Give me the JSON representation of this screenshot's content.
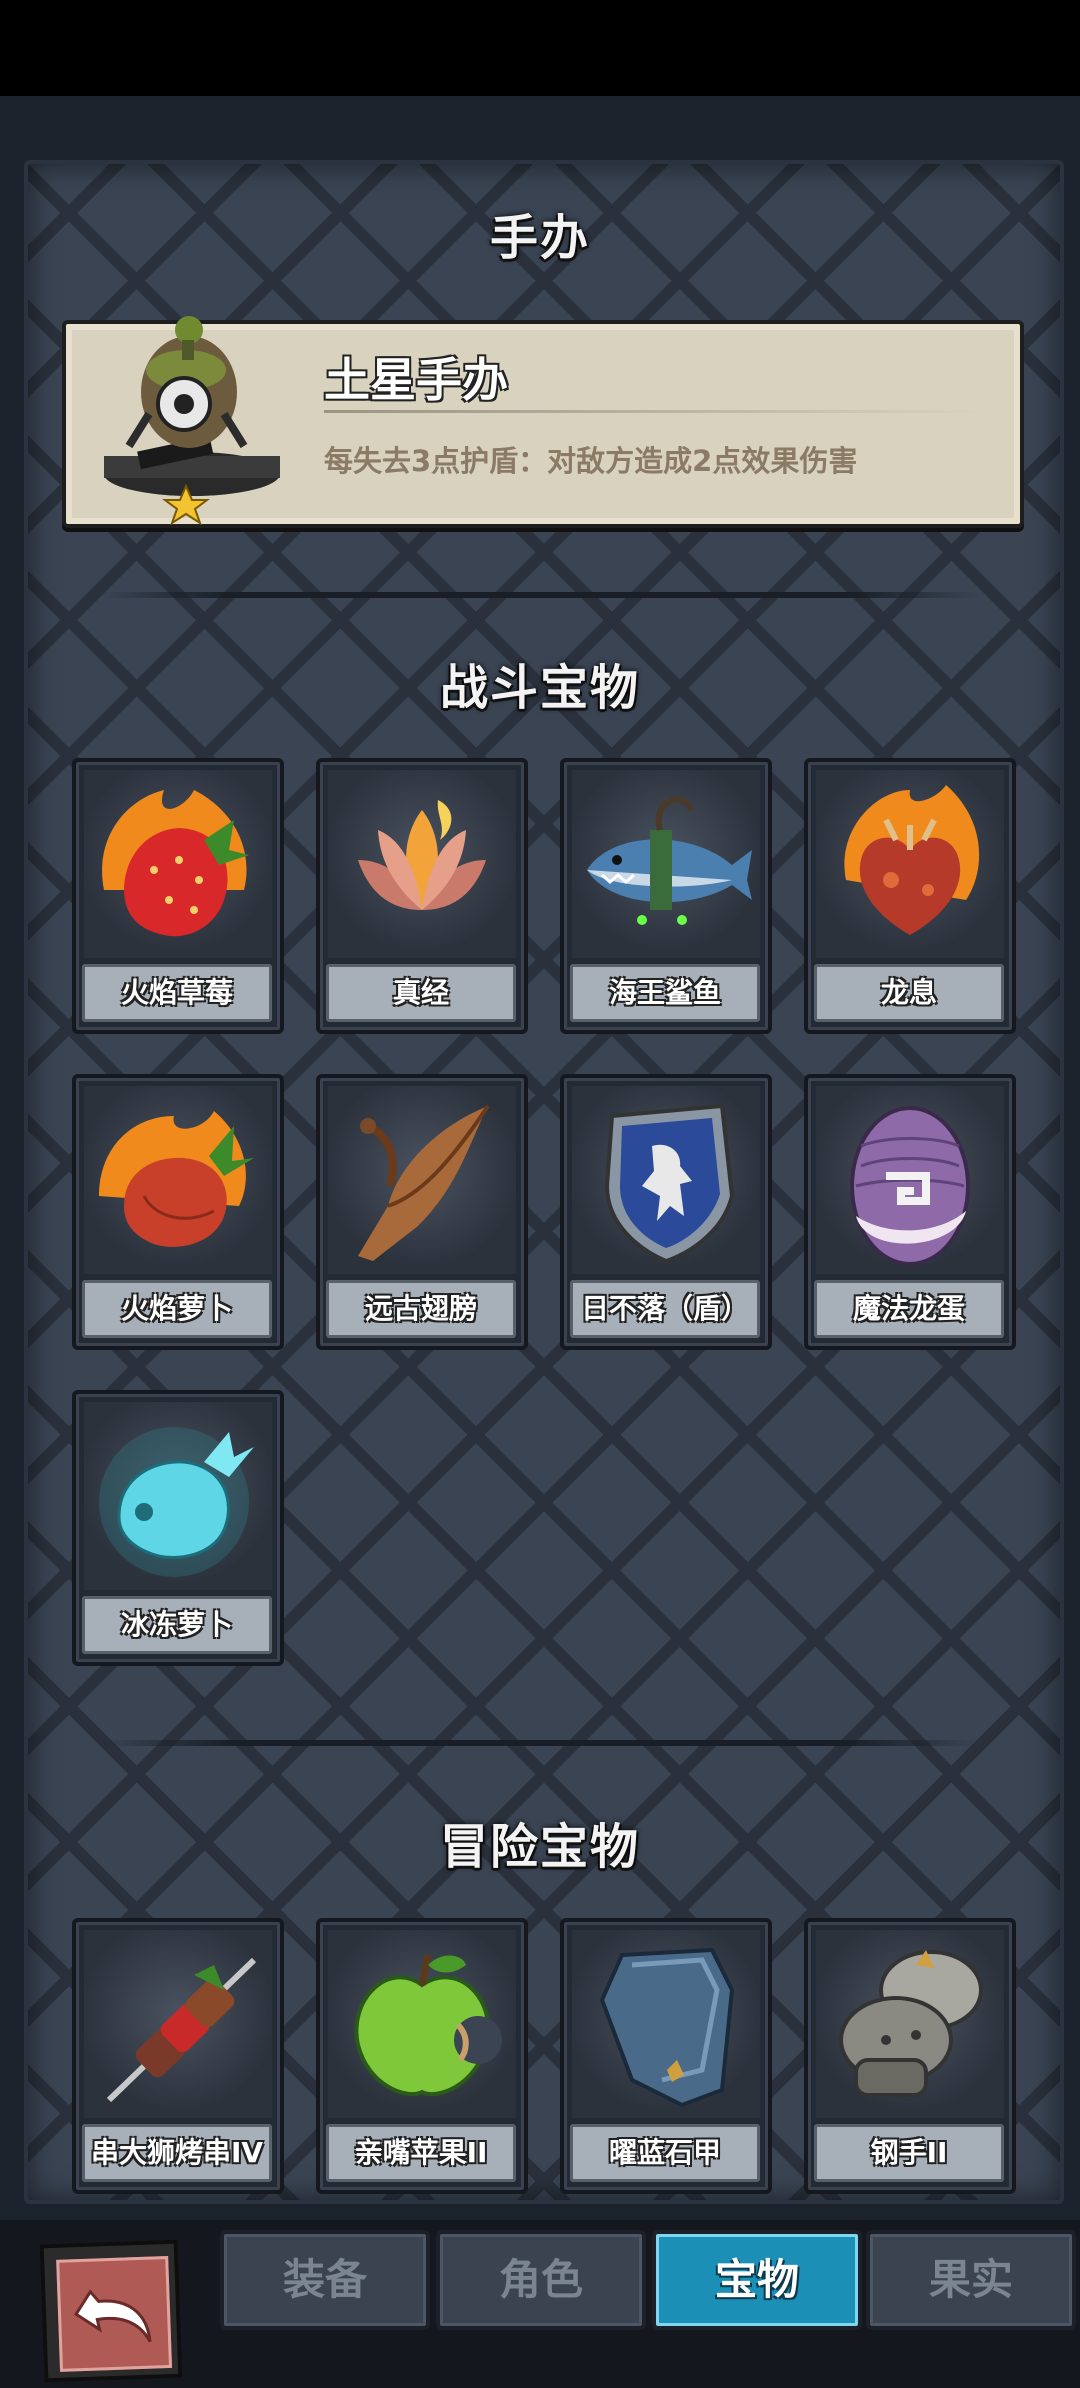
{
  "figure_section": {
    "title": "手办",
    "figure": {
      "name": "土星手办",
      "description": "每失去3点护盾：对敌方造成2点效果伤害"
    }
  },
  "battle_section": {
    "title": "战斗宝物",
    "items": [
      {
        "label": "火焰草莓",
        "icon": "flaming-strawberry-icon"
      },
      {
        "label": "真经",
        "icon": "burning-lotus-icon"
      },
      {
        "label": "海王鲨鱼",
        "icon": "shark-fish-icon"
      },
      {
        "label": "龙息",
        "icon": "flaming-heart-icon"
      },
      {
        "label": "火焰萝卜",
        "icon": "flaming-radish-icon"
      },
      {
        "label": "远古翅膀",
        "icon": "ancient-wing-icon"
      },
      {
        "label": "日不落（盾）",
        "icon": "lion-shield-icon"
      },
      {
        "label": "魔法龙蛋",
        "icon": "dragon-egg-icon"
      },
      {
        "label": "冰冻萝卜",
        "icon": "frozen-radish-icon"
      }
    ]
  },
  "adventure_section": {
    "title": "冒险宝物",
    "items": [
      {
        "label": "串大狮烤串IV",
        "icon": "kebab-skewer-icon"
      },
      {
        "label": "亲嘴苹果II",
        "icon": "bitten-apple-icon"
      },
      {
        "label": "曜蓝石甲",
        "icon": "blue-armor-icon"
      },
      {
        "label": "钢手II",
        "icon": "steel-gauntlet-icon"
      }
    ]
  },
  "tabs": [
    {
      "label": "装备",
      "active": false
    },
    {
      "label": "角色",
      "active": false
    },
    {
      "label": "宝物",
      "active": true
    },
    {
      "label": "果实",
      "active": false
    }
  ],
  "colors": {
    "active_tab": "#1c8fb6",
    "panel": "#3a4453",
    "figure_card": "#d8d2bf"
  }
}
